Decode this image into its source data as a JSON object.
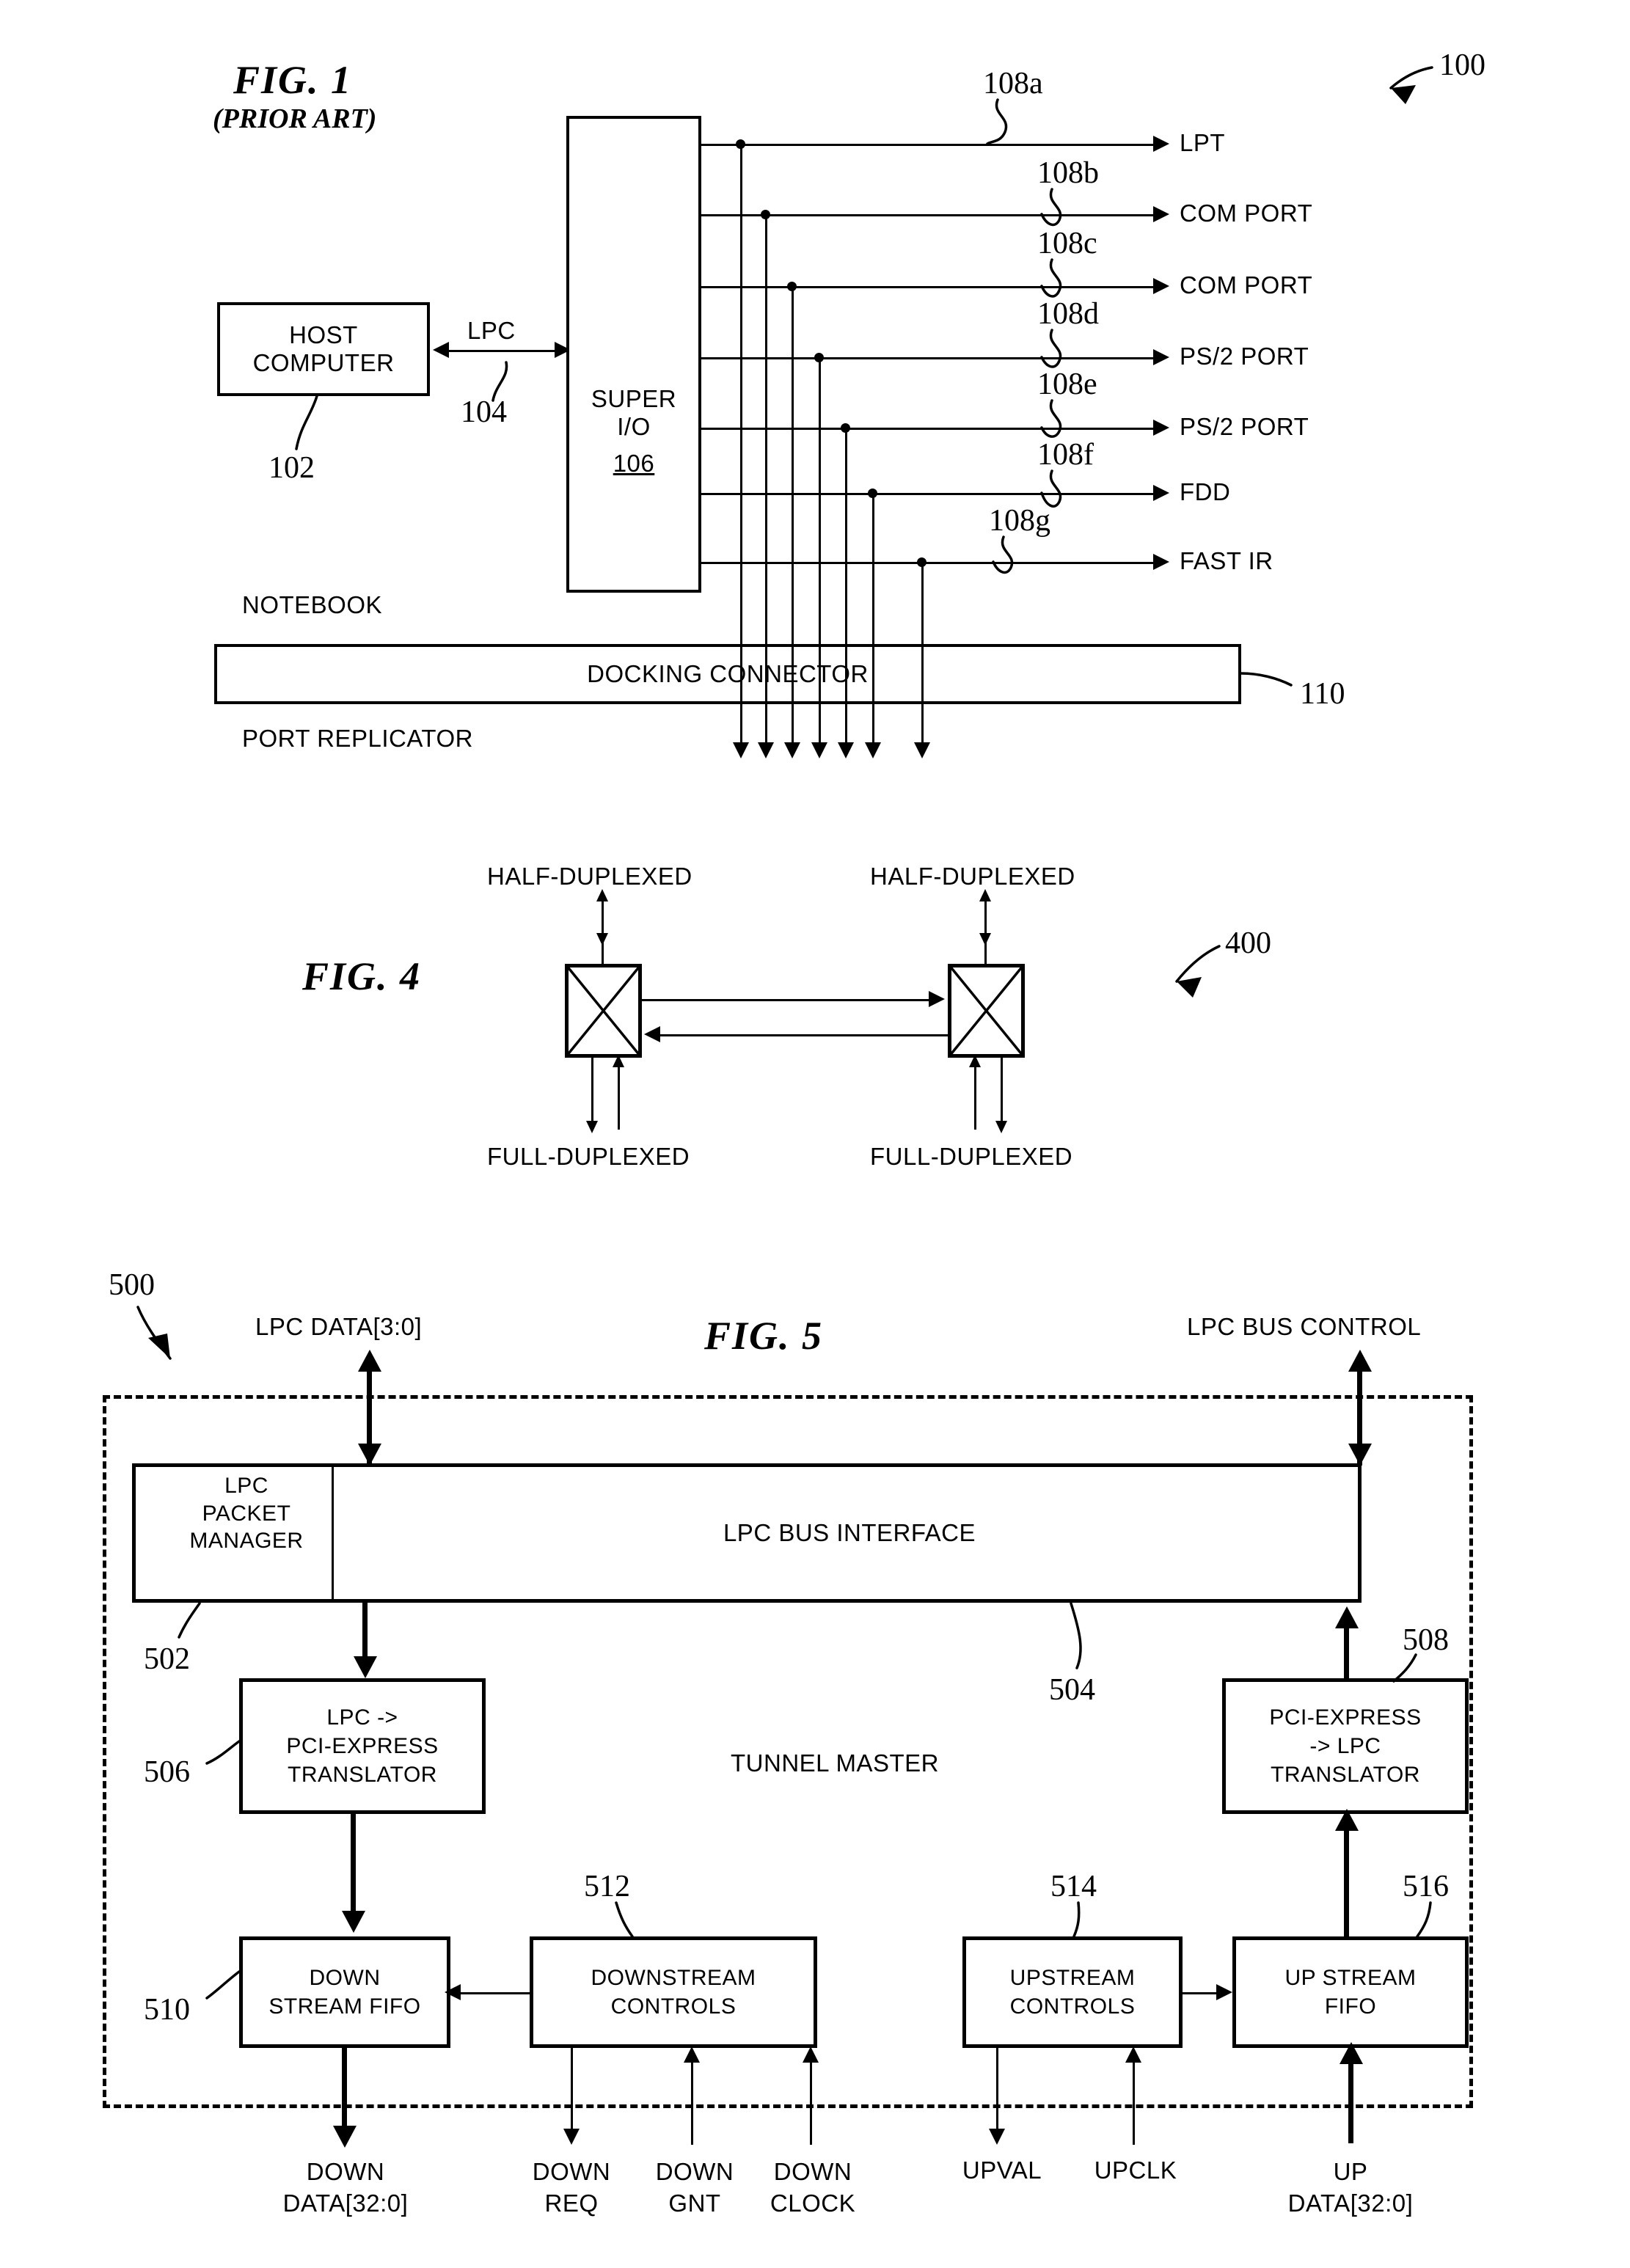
{
  "figures": [
    {
      "id": "fig1",
      "title": "FIG. 1",
      "subtitle": "(PRIOR ART)",
      "ref": "100",
      "blocks": {
        "host_computer": {
          "line1": "HOST",
          "line2": "COMPUTER",
          "ref": "102"
        },
        "bus": {
          "label": "LPC",
          "ref": "104"
        },
        "super_io": {
          "line1": "SUPER",
          "line2": "I/O",
          "ref": "106"
        },
        "docking_connector": {
          "label": "DOCKING CONNECTOR",
          "ref": "110"
        }
      },
      "zone_labels": {
        "top": "NOTEBOOK",
        "bottom": "PORT REPLICATOR"
      },
      "ports": [
        {
          "ref": "108a",
          "label": "LPT"
        },
        {
          "ref": "108b",
          "label": "COM PORT"
        },
        {
          "ref": "108c",
          "label": "COM PORT"
        },
        {
          "ref": "108d",
          "label": "PS/2 PORT"
        },
        {
          "ref": "108e",
          "label": "PS/2 PORT"
        },
        {
          "ref": "108f",
          "label": "FDD"
        },
        {
          "ref": "108g",
          "label": "FAST IR"
        }
      ]
    },
    {
      "id": "fig4",
      "title": "FIG. 4",
      "ref": "400",
      "labels": {
        "half_left": "HALF-DUPLEXED",
        "half_right": "HALF-DUPLEXED",
        "full_left": "FULL-DUPLEXED",
        "full_right": "FULL-DUPLEXED"
      }
    },
    {
      "id": "fig5",
      "title": "FIG. 5",
      "ref": "500",
      "top_signals": {
        "left": "LPC DATA[3:0]",
        "right": "LPC BUS CONTROL"
      },
      "blocks": {
        "lpc_packet_manager": {
          "line1": "LPC",
          "line2": "PACKET",
          "line3": "MANAGER",
          "ref": "502"
        },
        "lpc_bus_interface": {
          "label": "LPC BUS INTERFACE",
          "ref": "504"
        },
        "lpc_to_pcie_translator": {
          "line1": "LPC ->",
          "line2": "PCI-EXPRESS",
          "line3": "TRANSLATOR",
          "ref": "506"
        },
        "pcie_to_lpc_translator": {
          "line1": "PCI-EXPRESS",
          "line2": "-> LPC",
          "line3": "TRANSLATOR",
          "ref": "508"
        },
        "down_stream_fifo": {
          "line1": "DOWN",
          "line2": "STREAM FIFO",
          "ref": "510"
        },
        "downstream_controls": {
          "line1": "DOWNSTREAM",
          "line2": "CONTROLS",
          "ref": "512"
        },
        "upstream_controls": {
          "line1": "UPSTREAM",
          "line2": "CONTROLS",
          "ref": "514"
        },
        "up_stream_fifo": {
          "line1": "UP STREAM",
          "line2": "FIFO",
          "ref": "516"
        }
      },
      "center_label": "TUNNEL MASTER",
      "bottom_signals": [
        {
          "line1": "DOWN",
          "line2": "DATA[32:0]"
        },
        {
          "line1": "DOWN",
          "line2": "REQ"
        },
        {
          "line1": "DOWN",
          "line2": "GNT"
        },
        {
          "line1": "DOWN",
          "line2": "CLOCK"
        },
        {
          "line1": "UPVAL",
          "line2": ""
        },
        {
          "line1": "UPCLK",
          "line2": ""
        },
        {
          "line1": "UP",
          "line2": "DATA[32:0]"
        }
      ]
    }
  ],
  "colors": {
    "ink": "#000000",
    "paper": "#ffffff"
  }
}
